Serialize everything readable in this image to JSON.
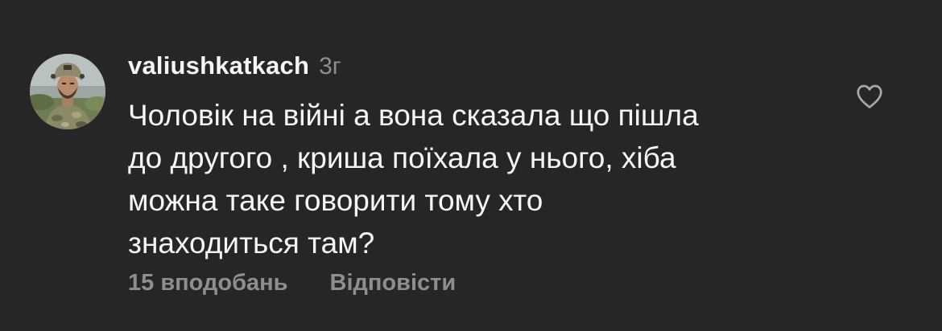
{
  "comment": {
    "username": "valiushkatkach",
    "time_ago": "3г",
    "text": "Чоловік на війні а вона сказала що пішла\nдо другого , криша поїхала у нього, хіба\nможна таке говорити тому хто\nзнаходиться там?",
    "likes": "15 вподобань",
    "reply_label": "Відповісти"
  },
  "icons": {
    "like": "heart-outline-icon",
    "avatar": "avatar-photo-soldier"
  },
  "colors": {
    "background": "#262626",
    "primary_text": "#f5f5f5",
    "secondary_text": "#8e8e8e"
  }
}
